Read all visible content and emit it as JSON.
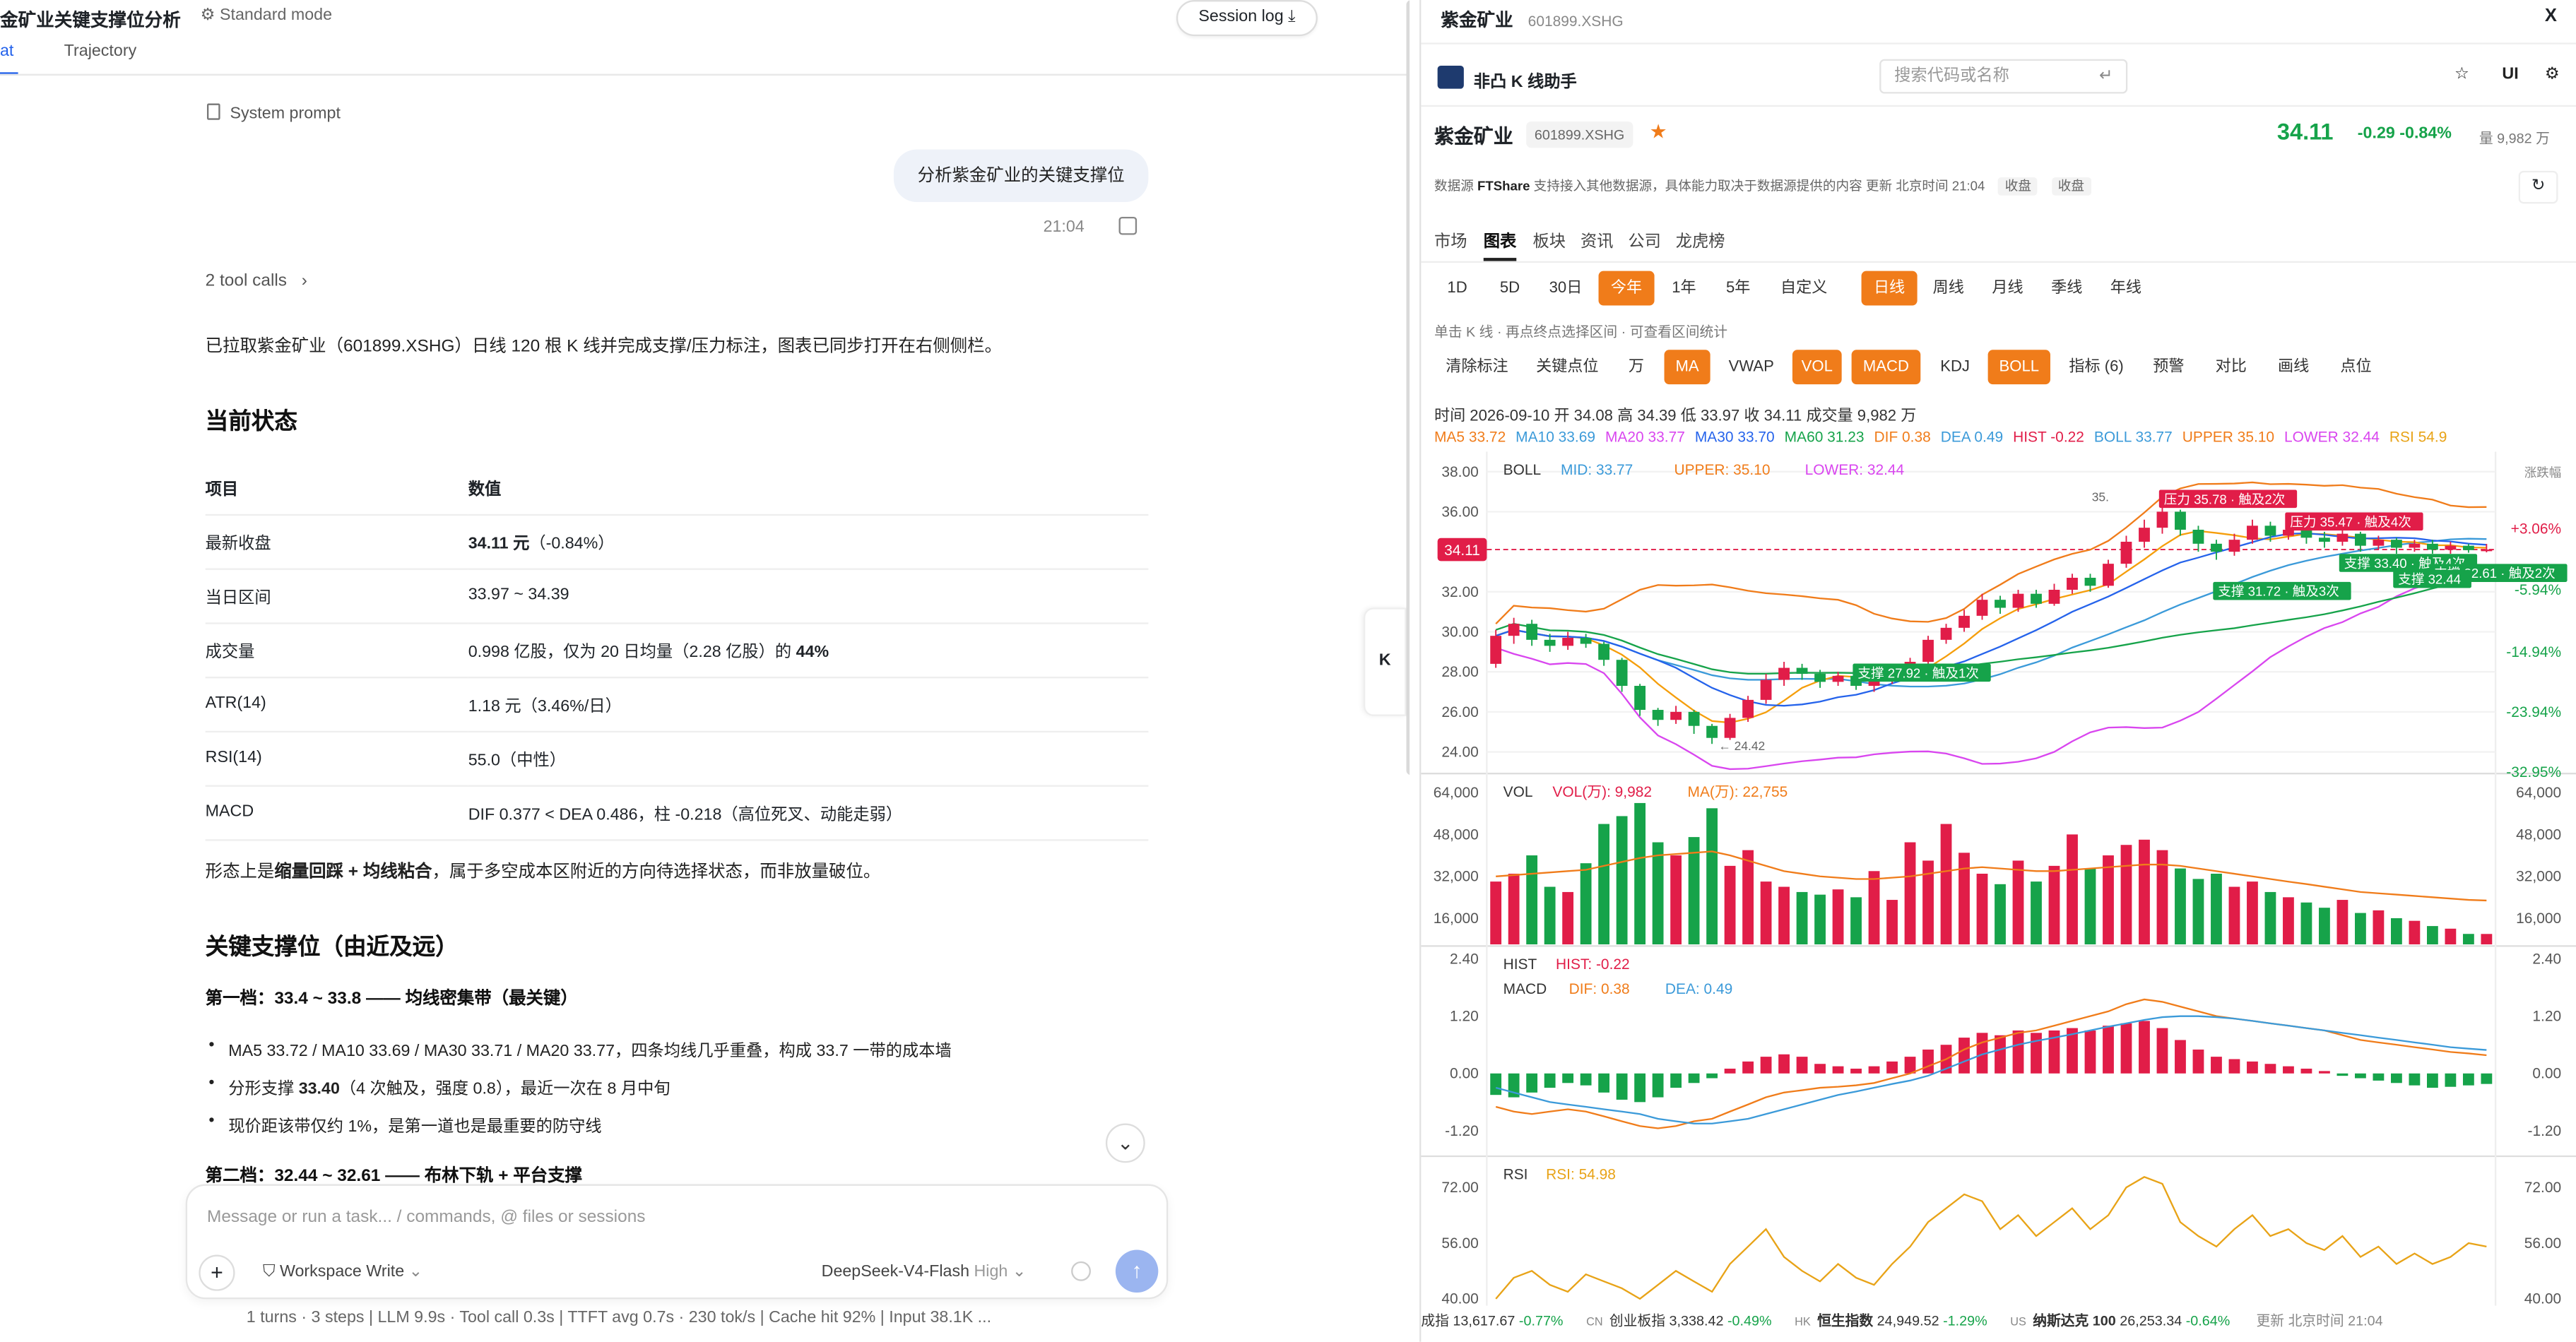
{
  "left": {
    "title": "金矿业关键支撑位分析",
    "mode": "Standard mode",
    "tabs": [
      "at",
      "Trajectory"
    ],
    "session_log": "Session log ⤓",
    "system_prompt": "System prompt",
    "user_message": "分析紫金矿业的关键支撑位",
    "timestamp": "21:04",
    "tool_calls": "2 tool calls",
    "intro": "已拉取紫金矿业（601899.XSHG）日线 120 根 K 线并完成支撑/压力标注，图表已同步打开在右侧侧栏。",
    "section_current": "当前状态",
    "table_headers": [
      "项目",
      "数值"
    ],
    "table_rows": [
      [
        "最新收盘",
        "34.11 元（-0.84%）"
      ],
      [
        "当日区间",
        "33.97 ~ 34.39"
      ],
      [
        "成交量",
        "0.998 亿股，仅为 20 日均量（2.28 亿股）的 44%"
      ],
      [
        "ATR(14)",
        "1.18 元（3.46%/日）"
      ],
      [
        "RSI(14)",
        "55.0（中性）"
      ],
      [
        "MACD",
        "DIF 0.377 < DEA 0.486，柱 -0.218（高位死叉、动能走弱）"
      ]
    ],
    "summary": "形态上是缩量回踩 + 均线粘合，属于多空成本区附近的方向待选择状态，而非放量破位。",
    "section_support": "关键支撑位（由近及远）",
    "tier1_title": "第一档：33.4 ~ 33.8 —— 均线密集带（最关键）",
    "tier1_bullets": [
      "MA5 33.72 / MA10 33.69 / MA30 33.71 / MA20 33.77，四条均线几乎重叠，构成 33.7 一带的成本墙",
      "分形支撑 33.40（4 次触及，强度 0.8），最近一次在 8 月中旬",
      "现价距该带仅约 1%，是第一道也是最重要的防守线"
    ],
    "tier2_title": "第二档：32.44 ~ 32.61 —— 布林下轨 + 平台支撑",
    "composer_placeholder": "Message or run a task... / commands, @ files or sessions",
    "workspace": "Workspace Write",
    "model": "DeepSeek-V4-Flash",
    "model_level": "High",
    "status_line": "1 turns · 3 steps   |   LLM 9.9s · Tool call 0.3s   |   TTFT avg 0.7s · 230 tok/s   |   Cache hit 92%   |   Input 38.1K ...",
    "k_tab": "K"
  },
  "right": {
    "title": "紫金矿业",
    "code": "601899.XSHG",
    "close": "X",
    "app_name": "非凸 K 线助手",
    "search_placeholder": "搜索代码或名称",
    "icons": [
      "star-icon",
      "UI",
      "gear-icon"
    ],
    "ui_label": "UI",
    "stock_name": "紫金矿业",
    "stock_code": "601899.XSHG",
    "price": "34.11",
    "change": "-0.29  -0.84%",
    "volume": "量 9,982 万",
    "source_line": "数据源 FTShare  支持接入其他数据源，具体能力取决于数据源提供的内容  更新 北京时间 21:04",
    "source_name": "FTShare",
    "source_rest": "支持接入其他数据源，具体能力取决于数据源提供的内容  更新 北京时间 21:04",
    "source_label": "数据源",
    "chips": [
      "收盘",
      "收盘"
    ],
    "nav_tabs": [
      "市场",
      "图表",
      "板块",
      "资讯",
      "公司",
      "龙虎榜"
    ],
    "ranges": [
      "1D",
      "5D",
      "30日",
      "今年",
      "1年",
      "5年",
      "自定义"
    ],
    "periods": [
      "日线",
      "周线",
      "月线",
      "季线",
      "年线"
    ],
    "hint": "单击 K 线 · 再点终点选择区间 · 可查看区间统计",
    "tools": [
      "清除标注",
      "关键点位",
      "万",
      "MA",
      "VWAP",
      "VOL",
      "MACD",
      "KDJ",
      "BOLL",
      "指标 (6)",
      "预警",
      "对比",
      "画线",
      "点位"
    ],
    "ohlc": "时间 2026-09-10   开 34.08   高 34.39   低 33.97   收 34.11   成交量 9,982 万",
    "ma_line": [
      {
        "t": "MA5 33.72",
        "c": "#f07c1a"
      },
      {
        "t": "MA10 33.69",
        "c": "#3b9ad9"
      },
      {
        "t": "MA20 33.77",
        "c": "#d946ef"
      },
      {
        "t": "MA30 33.70",
        "c": "#2563eb"
      },
      {
        "t": "MA60 31.23",
        "c": "#16a34a"
      },
      {
        "t": "DIF 0.38",
        "c": "#f07c1a"
      },
      {
        "t": "DEA 0.49",
        "c": "#3b9ad9"
      },
      {
        "t": "HIST -0.22",
        "c": "#e11d48"
      },
      {
        "t": "BOLL 33.77",
        "c": "#3b9ad9"
      },
      {
        "t": "UPPER 35.10",
        "c": "#f07c1a"
      },
      {
        "t": "LOWER 32.44",
        "c": "#d946ef"
      },
      {
        "t": "RSI 54.9",
        "c": "#e8a317"
      }
    ],
    "indices": [
      {
        "tag": "",
        "name": "成指",
        "val": "13,617.67",
        "chg": "-0.77%"
      },
      {
        "tag": "CN",
        "name": "创业板指",
        "val": "3,338.42",
        "chg": "-0.49%"
      },
      {
        "tag": "HK",
        "name": "恒生指数",
        "val": "24,949.52",
        "chg": "-1.29%"
      },
      {
        "tag": "US",
        "name": "纳斯达克 100",
        "val": "26,253.34",
        "chg": "-0.64%"
      }
    ],
    "index_update": "更新 北京时间 21:04"
  },
  "chart_data": {
    "type": "candlestick",
    "main": {
      "label": "BOLL",
      "legend": [
        {
          "t": "MID: 33.77",
          "c": "#3b9ad9"
        },
        {
          "t": "UPPER: 35.10",
          "c": "#f07c1a"
        },
        {
          "t": "LOWER: 32.44",
          "c": "#d946ef"
        }
      ],
      "ylim": [
        23.0,
        39.0
      ],
      "yticks": [
        "38.00",
        "36.00",
        "32.00",
        "30.00",
        "28.00",
        "26.00",
        "24.00"
      ],
      "ytick_vals": [
        38,
        36,
        32,
        30,
        28,
        26,
        24
      ],
      "pct_ticks": [
        {
          "t": "涨跌幅",
          "v": 38.0
        },
        {
          "t": "+3.06%",
          "v": 35.15
        },
        {
          "t": "-5.94%",
          "v": 32.1
        },
        {
          "t": "-14.94%",
          "v": 29.0
        },
        {
          "t": "-23.94%",
          "v": 26.0
        },
        {
          "t": "-32.95%",
          "v": 23.0
        }
      ],
      "last_price": 34.11,
      "last_label": "34.11",
      "low_mark": {
        "label": "24.42",
        "i": 12,
        "v": 24.42
      },
      "high_mark": {
        "label": "35.",
        "i": 34,
        "v": 36.2
      },
      "resistances": [
        {
          "label": "压力 35.78 · 触及2次",
          "i": 37,
          "v": 36.6
        },
        {
          "label": "压力 35.47 · 触及4次",
          "i": 44,
          "v": 35.47
        }
      ],
      "supports": [
        {
          "label": "支撑 27.92 · 触及1次",
          "i": 20,
          "v": 27.92
        },
        {
          "label": "支撑 33.40 · 触及4次",
          "i": 47,
          "v": 33.4
        },
        {
          "label": "支撑 31.72 · 触及3次",
          "i": 40,
          "v": 32.0
        },
        {
          "label": "支撑 32.61 · 触及2次",
          "i": 52,
          "v": 32.9
        },
        {
          "label": "支撑 32.44",
          "i": 50,
          "v": 32.6
        }
      ],
      "candles": [
        [
          28.4,
          29.8,
          30.1,
          28.2
        ],
        [
          29.8,
          30.4,
          30.7,
          29.4
        ],
        [
          30.4,
          29.6,
          30.6,
          29.3
        ],
        [
          29.6,
          29.3,
          29.9,
          29.0
        ],
        [
          29.3,
          29.7,
          30.0,
          29.1
        ],
        [
          29.7,
          29.4,
          29.9,
          29.2
        ],
        [
          29.4,
          28.6,
          29.5,
          28.3
        ],
        [
          28.6,
          27.3,
          28.7,
          27.0
        ],
        [
          27.3,
          26.1,
          27.4,
          25.8
        ],
        [
          26.1,
          25.6,
          26.2,
          25.3
        ],
        [
          25.6,
          26.0,
          26.3,
          25.4
        ],
        [
          26.0,
          25.3,
          26.1,
          24.9
        ],
        [
          25.3,
          24.7,
          25.4,
          24.4
        ],
        [
          24.7,
          25.7,
          25.9,
          24.6
        ],
        [
          25.7,
          26.6,
          26.8,
          25.5
        ],
        [
          26.6,
          27.6,
          27.9,
          26.4
        ],
        [
          27.6,
          28.2,
          28.5,
          27.3
        ],
        [
          28.2,
          27.9,
          28.4,
          27.6
        ],
        [
          27.9,
          27.5,
          28.1,
          27.2
        ],
        [
          27.5,
          27.8,
          28.0,
          27.3
        ],
        [
          27.8,
          27.3,
          28.0,
          27.1
        ],
        [
          27.3,
          27.6,
          27.8,
          27.0
        ],
        [
          27.6,
          28.0,
          28.2,
          27.4
        ],
        [
          28.0,
          28.5,
          28.7,
          27.8
        ],
        [
          28.5,
          29.6,
          29.8,
          28.3
        ],
        [
          29.6,
          30.2,
          30.4,
          29.4
        ],
        [
          30.2,
          30.8,
          31.1,
          30.0
        ],
        [
          30.8,
          31.6,
          31.9,
          30.6
        ],
        [
          31.6,
          31.2,
          31.8,
          30.9
        ],
        [
          31.2,
          31.9,
          32.1,
          31.0
        ],
        [
          31.9,
          31.4,
          32.1,
          31.2
        ],
        [
          31.4,
          32.1,
          32.4,
          31.3
        ],
        [
          32.1,
          32.7,
          32.9,
          31.9
        ],
        [
          32.7,
          32.3,
          32.9,
          32.0
        ],
        [
          32.3,
          33.4,
          33.6,
          32.2
        ],
        [
          33.4,
          34.5,
          34.8,
          33.2
        ],
        [
          34.5,
          35.2,
          35.6,
          34.2
        ],
        [
          35.2,
          36.0,
          36.3,
          34.9
        ],
        [
          36.0,
          35.1,
          36.1,
          34.8
        ],
        [
          35.1,
          34.4,
          35.3,
          34.0
        ],
        [
          34.4,
          34.0,
          34.6,
          33.6
        ],
        [
          34.0,
          34.6,
          34.9,
          33.8
        ],
        [
          34.6,
          35.3,
          35.6,
          34.4
        ],
        [
          35.3,
          34.8,
          35.5,
          34.5
        ],
        [
          34.8,
          35.1,
          35.4,
          34.6
        ],
        [
          35.1,
          34.7,
          35.3,
          34.4
        ],
        [
          34.7,
          34.5,
          35.0,
          34.2
        ],
        [
          34.5,
          34.9,
          35.2,
          34.3
        ],
        [
          34.9,
          34.3,
          35.0,
          34.0
        ],
        [
          34.3,
          34.6,
          34.8,
          34.1
        ],
        [
          34.6,
          34.2,
          34.7,
          33.9
        ],
        [
          34.2,
          34.4,
          34.6,
          34.0
        ],
        [
          34.4,
          34.1,
          34.6,
          33.9
        ],
        [
          34.1,
          34.3,
          34.5,
          33.9
        ],
        [
          34.3,
          34.08,
          34.4,
          33.95
        ],
        [
          34.08,
          34.11,
          34.39,
          33.97
        ]
      ]
    },
    "volume": {
      "label": "VOL",
      "legend": [
        {
          "t": "VOL(万): 9,982",
          "c": "#e11d48"
        },
        {
          "t": "MA(万): 22,755",
          "c": "#f07c1a"
        }
      ],
      "yticks": [
        "64,000",
        "48,000",
        "32,000",
        "16,000"
      ],
      "ytick_vals": [
        64000,
        48000,
        32000,
        16000
      ],
      "ylim": [
        6000,
        70000
      ],
      "values": [
        30000,
        33000,
        40000,
        28000,
        26000,
        37000,
        52000,
        55000,
        60000,
        45000,
        40000,
        47000,
        58000,
        36000,
        42000,
        30000,
        28000,
        26000,
        25000,
        27000,
        24000,
        34000,
        23000,
        45000,
        38000,
        52000,
        41000,
        33000,
        29000,
        38000,
        30000,
        36000,
        48000,
        35000,
        40000,
        44000,
        46000,
        42000,
        35000,
        31000,
        33000,
        28000,
        30000,
        26000,
        24000,
        22000,
        20000,
        23000,
        18000,
        19000,
        16000,
        15000,
        13000,
        12000,
        10000,
        9982
      ],
      "ma": [
        32000,
        32500,
        33000,
        33500,
        34000,
        34500,
        36000,
        37500,
        39000,
        40000,
        40500,
        41000,
        41500,
        40000,
        38000,
        36000,
        34000,
        33000,
        32000,
        31500,
        31000,
        31000,
        31500,
        32000,
        33000,
        34000,
        35000,
        35500,
        35000,
        34500,
        34000,
        34000,
        34500,
        35000,
        35500,
        36000,
        36500,
        36500,
        36000,
        35000,
        34000,
        33000,
        32000,
        31000,
        30000,
        29000,
        28000,
        27000,
        26000,
        25500,
        25000,
        24500,
        24000,
        23500,
        23000,
        22755
      ]
    },
    "macd": {
      "label_hist": "HIST",
      "label_macd": "MACD",
      "legend_hist": {
        "t": "HIST: -0.22",
        "c": "#e11d48"
      },
      "legend": [
        {
          "t": "DIF: 0.38",
          "c": "#f07c1a"
        },
        {
          "t": "DEA: 0.49",
          "c": "#3b9ad9"
        }
      ],
      "yticks": [
        "2.40",
        "1.20",
        "0.00",
        "-1.20"
      ],
      "ytick_vals": [
        2.4,
        1.2,
        0.0,
        -1.2
      ],
      "ylim": [
        -1.7,
        2.6
      ],
      "hist": [
        -0.45,
        -0.5,
        -0.4,
        -0.3,
        -0.2,
        -0.25,
        -0.4,
        -0.55,
        -0.6,
        -0.5,
        -0.3,
        -0.2,
        -0.1,
        0.1,
        0.25,
        0.35,
        0.4,
        0.35,
        0.2,
        0.15,
        0.1,
        0.15,
        0.25,
        0.35,
        0.5,
        0.6,
        0.75,
        0.85,
        0.8,
        0.9,
        0.85,
        0.9,
        0.95,
        0.9,
        1.0,
        1.05,
        1.1,
        0.95,
        0.7,
        0.5,
        0.35,
        0.3,
        0.25,
        0.2,
        0.15,
        0.1,
        0.05,
        -0.05,
        -0.1,
        -0.15,
        -0.2,
        -0.25,
        -0.3,
        -0.28,
        -0.25,
        -0.22
      ],
      "dif": [
        -0.7,
        -0.8,
        -0.85,
        -0.8,
        -0.75,
        -0.8,
        -0.9,
        -1.0,
        -1.1,
        -1.15,
        -1.1,
        -1.0,
        -0.95,
        -0.8,
        -0.65,
        -0.5,
        -0.4,
        -0.35,
        -0.3,
        -0.28,
        -0.25,
        -0.2,
        -0.1,
        0.0,
        0.15,
        0.3,
        0.5,
        0.65,
        0.75,
        0.85,
        0.9,
        1.0,
        1.1,
        1.2,
        1.3,
        1.45,
        1.55,
        1.5,
        1.4,
        1.3,
        1.2,
        1.15,
        1.1,
        1.05,
        1.0,
        0.95,
        0.9,
        0.8,
        0.7,
        0.65,
        0.6,
        0.55,
        0.5,
        0.45,
        0.42,
        0.38
      ],
      "dea": [
        -0.3,
        -0.4,
        -0.5,
        -0.6,
        -0.65,
        -0.7,
        -0.75,
        -0.8,
        -0.85,
        -0.95,
        -1.0,
        -1.05,
        -1.05,
        -1.0,
        -0.95,
        -0.85,
        -0.75,
        -0.65,
        -0.55,
        -0.45,
        -0.38,
        -0.3,
        -0.22,
        -0.15,
        -0.05,
        0.1,
        0.25,
        0.4,
        0.5,
        0.6,
        0.68,
        0.75,
        0.82,
        0.9,
        0.98,
        1.05,
        1.12,
        1.18,
        1.2,
        1.2,
        1.18,
        1.15,
        1.1,
        1.05,
        1.0,
        0.95,
        0.9,
        0.85,
        0.8,
        0.75,
        0.7,
        0.65,
        0.6,
        0.55,
        0.52,
        0.49
      ]
    },
    "rsi": {
      "label": "RSI",
      "legend": {
        "t": "RSI: 54.98",
        "c": "#e8a317"
      },
      "yticks": [
        "72.00",
        "56.00",
        "40.00"
      ],
      "ytick_vals": [
        72,
        56,
        40
      ],
      "ylim": [
        38,
        80
      ],
      "values": [
        40,
        46,
        48,
        44,
        42,
        47,
        45,
        43,
        40,
        44,
        48,
        45,
        42,
        50,
        55,
        60,
        52,
        48,
        45,
        50,
        46,
        44,
        50,
        55,
        62,
        66,
        70,
        68,
        60,
        64,
        58,
        62,
        66,
        60,
        64,
        72,
        75,
        73,
        62,
        58,
        55,
        60,
        64,
        58,
        60,
        56,
        54,
        58,
        52,
        55,
        50,
        53,
        50,
        52,
        56,
        54.98
      ]
    }
  }
}
